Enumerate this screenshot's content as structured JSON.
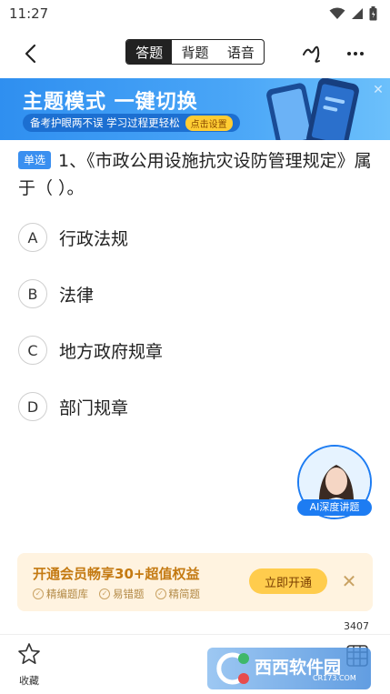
{
  "status_bar": {
    "time": "11:27",
    "icons": [
      "wifi-icon",
      "signal-icon",
      "battery-icon"
    ]
  },
  "nav": {
    "tabs": [
      {
        "label": "答题",
        "active": true
      },
      {
        "label": "背题",
        "active": false
      },
      {
        "label": "语音",
        "active": false
      }
    ]
  },
  "banner": {
    "title": "主题模式 一键切换",
    "subtitle": "备考护眼两不误 学习过程更轻松",
    "cta": "点击设置"
  },
  "question": {
    "type_tag": "单选",
    "text": "1、《市政公用设施抗灾设防管理规定》属于（   ）。",
    "options": [
      {
        "letter": "A",
        "text": "行政法规"
      },
      {
        "letter": "B",
        "text": "法律"
      },
      {
        "letter": "C",
        "text": "地方政府规章"
      },
      {
        "letter": "D",
        "text": "部门规章"
      }
    ]
  },
  "ai_lecture": {
    "label": "AI深度讲题"
  },
  "vip": {
    "title": "开通会员畅享30+超值权益",
    "features": [
      "精编题库",
      "易错题",
      "精简题"
    ],
    "button": "立即开通"
  },
  "counter": "3407",
  "bottom_bar": {
    "favorite_label": "收藏"
  },
  "watermark": {
    "brand": "西西软件园",
    "site": "CR173.COM"
  },
  "colors": {
    "accent": "#3a8ff0",
    "vip_text": "#c47a12",
    "vip_bg": "#fff3e0"
  }
}
